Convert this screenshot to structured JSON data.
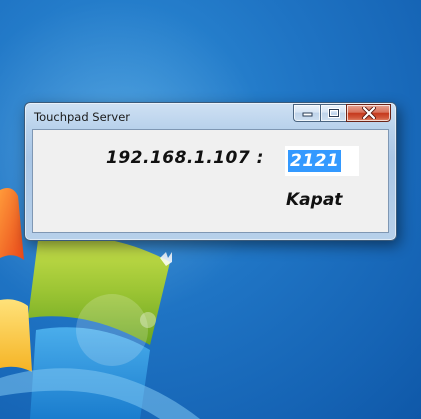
{
  "window": {
    "title": "Touchpad Server",
    "controls": [
      "minimize",
      "maximize",
      "close"
    ]
  },
  "server": {
    "ip_label": "192.168.1.107 :",
    "port_value": "2121"
  },
  "close_button_label": "Kapat",
  "icons": {
    "minimize": "minimize-icon",
    "maximize": "maximize-icon",
    "close": "close-icon"
  },
  "colors": {
    "desktop_blue": "#1f74c4",
    "selection": "#3399ff",
    "close_red": "#c5391d"
  }
}
